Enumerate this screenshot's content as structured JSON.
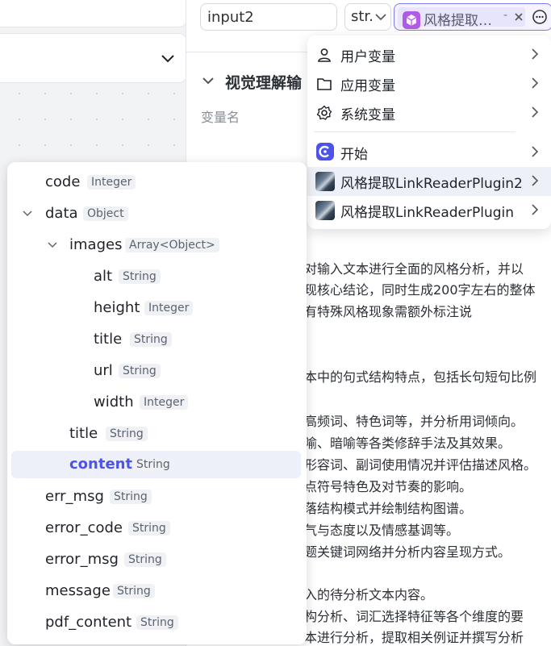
{
  "top_inputs": {
    "name_value": "input2",
    "type_value": "str.",
    "variable_ref": "风格提取…",
    "variable_dash": "-"
  },
  "section": {
    "title": "视觉理解输",
    "field_label": "变量名"
  },
  "body_lines": [
    "对输入文本进行全面的风格分析，并以",
    "现核心结论，同时生成200字左右的整体",
    "有特殊风格现象需额外标注说",
    "本中的句式结构特点，包括长句短句比例",
    "高频词、特色词等，并分析用词倾向。",
    "喻、暗喻等各类修辞手法及其效果。",
    "形容词、副词使用情况并评估描述风格。",
    "点符号特色及对节奏的影响。",
    "落结构模式并绘制结构图谱。",
    "气与态度以及情感基调等。",
    "题关键词网络并分析内容呈现方式。",
    "入的待分析文本内容。",
    "构分析、词汇选择特征等各个维度的要",
    "本进行分析，提取相关例证并撰写分析"
  ],
  "menu": {
    "items": [
      {
        "label": "用户变量",
        "icon": "user-icon"
      },
      {
        "label": "应用变量",
        "icon": "folder-icon"
      },
      {
        "label": "系统变量",
        "icon": "gear-icon"
      },
      {
        "label": "开始",
        "icon": "start-node-icon"
      },
      {
        "label": "风格提取LinkReaderPlugin2",
        "icon": "plugin-thumbnail-icon"
      },
      {
        "label": "风格提取LinkReaderPlugin",
        "icon": "plugin-thumbnail-icon"
      }
    ]
  },
  "tree": {
    "rows": [
      {
        "key": "code",
        "type": "Integer"
      },
      {
        "key": "data",
        "type": "Object"
      },
      {
        "key": "images",
        "type": "Array<Object>"
      },
      {
        "key": "alt",
        "type": "String"
      },
      {
        "key": "height",
        "type": "Integer"
      },
      {
        "key": "title",
        "type": "String"
      },
      {
        "key": "url",
        "type": "String"
      },
      {
        "key": "width",
        "type": "Integer"
      },
      {
        "key": "title",
        "type": "String"
      },
      {
        "key": "content",
        "type": "String"
      },
      {
        "key": "err_msg",
        "type": "String"
      },
      {
        "key": "error_code",
        "type": "String"
      },
      {
        "key": "error_msg",
        "type": "String"
      },
      {
        "key": "message",
        "type": "String"
      },
      {
        "key": "pdf_content",
        "type": "String"
      }
    ]
  },
  "colors": {
    "accent": "#4d53e8",
    "selected_border": "#7d7bf2",
    "highlight_row": "#eef0f9"
  }
}
